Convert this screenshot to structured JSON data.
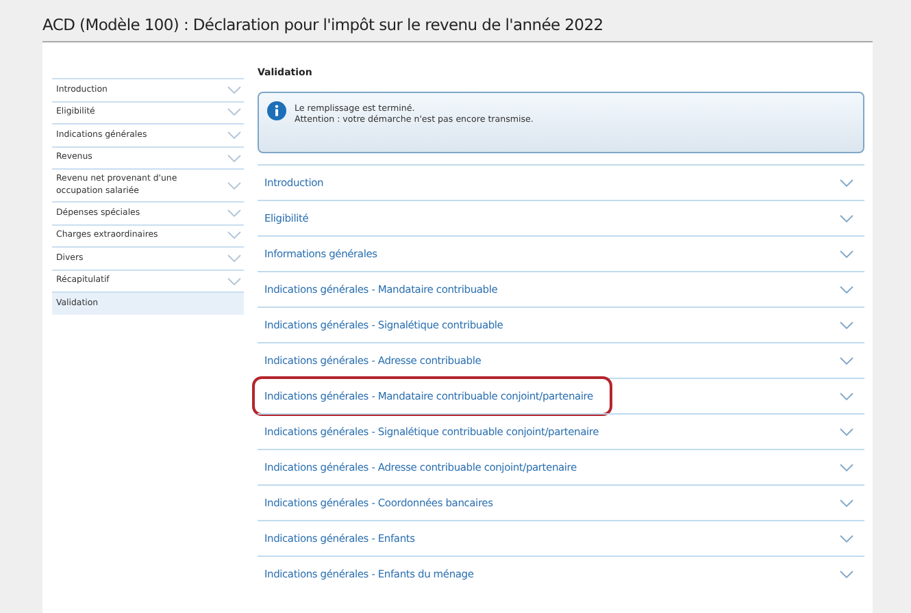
{
  "window": {
    "title": "ACD (Modèle 100) : Déclaration pour l'impôt sur le revenu de l'année 2022"
  },
  "sidebar": {
    "items": [
      {
        "label": "Introduction",
        "selected": false
      },
      {
        "label": "Eligibilité",
        "selected": false
      },
      {
        "label": "Indications générales",
        "selected": false
      },
      {
        "label": "Revenus",
        "selected": false
      },
      {
        "label": "Revenu net provenant d'une occupation salariée",
        "selected": false
      },
      {
        "label": "Dépenses spéciales",
        "selected": false
      },
      {
        "label": "Charges extraordinaires",
        "selected": false
      },
      {
        "label": "Divers",
        "selected": false
      },
      {
        "label": "Récapitulatif",
        "selected": false
      },
      {
        "label": "Validation",
        "selected": true
      }
    ]
  },
  "main": {
    "heading": "Validation",
    "info": {
      "lines": [
        "Le remplissage est terminé.",
        "Attention : votre démarche n'est pas encore transmise."
      ]
    },
    "sections": [
      {
        "label": "Introduction",
        "highlighted": false
      },
      {
        "label": "Eligibilité",
        "highlighted": false
      },
      {
        "label": "Informations générales",
        "highlighted": false
      },
      {
        "label": "Indications générales - Mandataire contribuable",
        "highlighted": false
      },
      {
        "label": "Indications générales - Signalétique contribuable",
        "highlighted": false
      },
      {
        "label": "Indications générales - Adresse contribuable",
        "highlighted": false
      },
      {
        "label": "Indications générales - Mandataire contribuable conjoint/partenaire",
        "highlighted": true
      },
      {
        "label": "Indications générales - Signalétique contribuable conjoint/partenaire",
        "highlighted": false
      },
      {
        "label": "Indications générales - Adresse contribuable conjoint/partenaire",
        "highlighted": false
      },
      {
        "label": "Indications générales - Coordonnées bancaires",
        "highlighted": false
      },
      {
        "label": "Indications générales - Enfants",
        "highlighted": false
      },
      {
        "label": "Indications générales - Enfants du ménage",
        "highlighted": false
      }
    ]
  }
}
